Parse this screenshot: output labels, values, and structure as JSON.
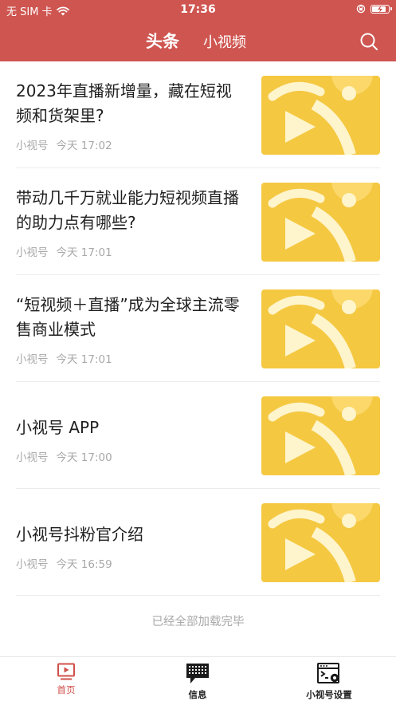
{
  "status_bar": {
    "carrier": "无 SIM 卡",
    "time": "17:36"
  },
  "header": {
    "tabs": [
      {
        "label": "头条",
        "active": true
      },
      {
        "label": "小视频",
        "active": false
      }
    ],
    "search_icon": "search-icon"
  },
  "articles": [
    {
      "title": "2023年直播新增量，藏在短视频和货架里?",
      "source": "小视号",
      "time": "今天 17:02"
    },
    {
      "title": "带动几千万就业能力短视频直播的助力点有哪些?",
      "source": "小视号",
      "time": "今天 17:01"
    },
    {
      "title": "“短视频＋直播”成为全球主流零售商业模式",
      "source": "小视号",
      "time": "今天 17:01"
    },
    {
      "title": "小视号 APP",
      "source": "小视号",
      "time": "今天 17:00"
    },
    {
      "title": "小视号抖粉官介绍",
      "source": "小视号",
      "time": "今天 16:59"
    }
  ],
  "footer_note": "已经全部加载完毕",
  "tabbar": {
    "items": [
      {
        "label": "首页",
        "icon": "home-video-icon",
        "active": true
      },
      {
        "label": "信息",
        "icon": "chat-bubble-icon",
        "active": false
      },
      {
        "label": "小视号设置",
        "icon": "settings-window-icon",
        "active": false
      }
    ]
  },
  "colors": {
    "brand": "#cf5550",
    "thumb_yellow": "#f5c842",
    "active_tab": "#d0504b"
  }
}
